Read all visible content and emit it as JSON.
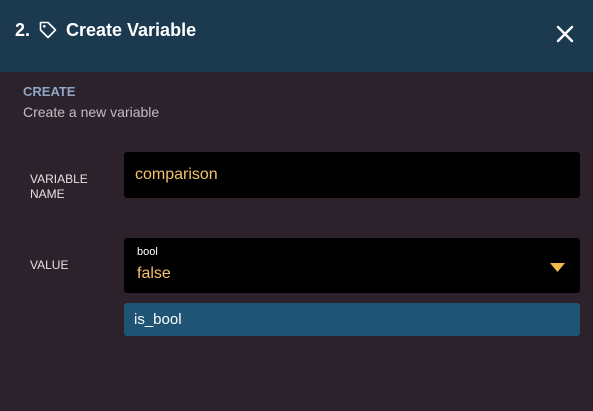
{
  "header": {
    "step_number": "2.",
    "title": "Create Variable",
    "tag_icon": "tag-icon",
    "close_icon": "close-icon",
    "background": "#1c3a4f"
  },
  "section": {
    "title": "CREATE",
    "subtitle": "Create a new variable"
  },
  "fields": {
    "name": {
      "label": "VARIABLE NAME",
      "value": "comparison"
    },
    "value": {
      "label": "VALUE",
      "type": "bool",
      "selected": "false",
      "caret_icon": "caret-down-icon"
    }
  },
  "suggestion": {
    "label": "is_bool"
  },
  "colors": {
    "background": "#2b222c",
    "accent_value": "#f3c26b",
    "accent_caret": "#f0b94d",
    "suggestion_bg": "#205474",
    "section_title": "#8fa6c7"
  }
}
